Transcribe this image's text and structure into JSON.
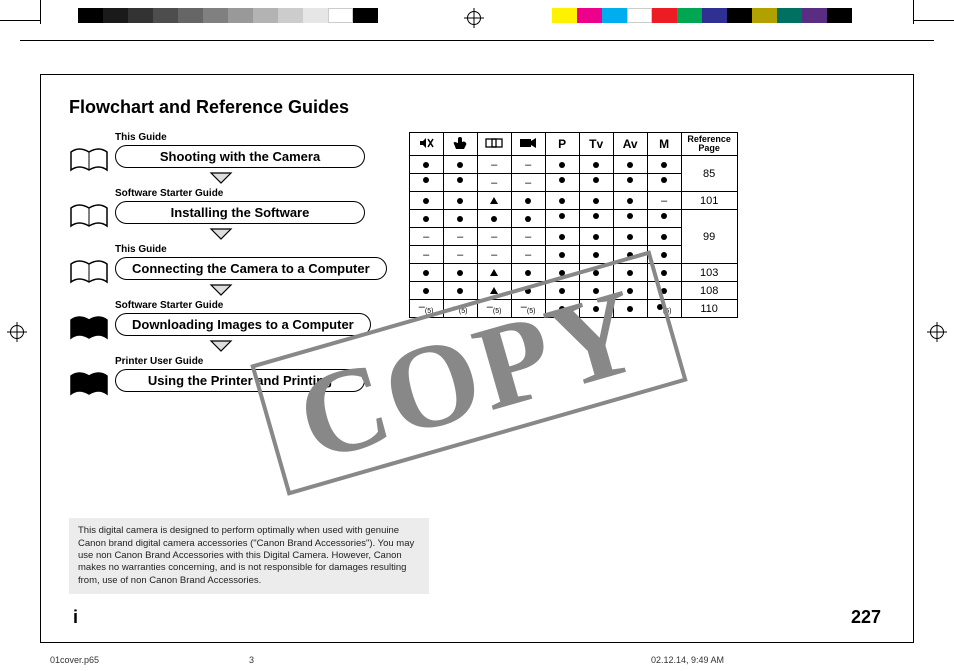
{
  "title": "Flowchart and Reference Guides",
  "steps": [
    {
      "guide": "This Guide",
      "label": "Shooting with the Camera",
      "book": "open"
    },
    {
      "guide": "Software Starter Guide",
      "label": "Installing the Software",
      "book": "open"
    },
    {
      "guide": "This Guide",
      "label": "Connecting the Camera to a Computer",
      "book": "open"
    },
    {
      "guide": "Software Starter Guide",
      "label": "Downloading Images to a Computer",
      "book": "solid"
    },
    {
      "guide": "Printer User Guide",
      "label": "Using the Printer and Printing",
      "book": "solid"
    }
  ],
  "table": {
    "headers": [
      "mute-icon",
      "hand-icon",
      "panorama-icon",
      "movie-icon",
      "P",
      "Tv",
      "Av",
      "M"
    ],
    "ref_header": "Reference Page",
    "rows": [
      {
        "cells": [
          "●",
          "●",
          "–",
          "–",
          "●",
          "●",
          "●",
          "●"
        ],
        "ref": "85",
        "refspan": 2
      },
      {
        "cells": [
          "●*",
          "●*",
          "–",
          "–",
          "●*",
          "●*",
          "●*",
          "●*"
        ],
        "ref": ""
      },
      {
        "cells": [
          "●",
          "●",
          "▲",
          "●",
          "●",
          "●",
          "●",
          "–"
        ],
        "ref": "101",
        "refspan": 1
      },
      {
        "cells": [
          "●",
          "●",
          "●",
          "●",
          "●*",
          "●*",
          "●*",
          "●*"
        ],
        "ref": "99",
        "refspan": 3
      },
      {
        "cells": [
          "–",
          "–",
          "–",
          "–",
          "●",
          "●",
          "●",
          "●"
        ],
        "ref": ""
      },
      {
        "cells": [
          "–",
          "–",
          "–",
          "–",
          "●",
          "●",
          "●",
          "●"
        ],
        "ref": ""
      },
      {
        "cells": [
          "●",
          "●",
          "▲",
          "●",
          "●",
          "●",
          "●",
          "●"
        ],
        "ref": "103",
        "refspan": 1
      },
      {
        "cells": [
          "●",
          "●",
          "▲",
          "●",
          "●",
          "●",
          "●",
          "●"
        ],
        "ref": "108",
        "refspan": 1
      },
      {
        "cells": [
          "–(5)",
          "–(5)",
          "–(5)",
          "–(5)",
          "●",
          "●",
          "●",
          "●(6)"
        ],
        "ref": "110",
        "refspan": 1
      }
    ]
  },
  "watermark": "COPY",
  "disclaimer": "This digital camera is designed to perform optimally when used with genuine Canon brand digital camera accessories (\"Canon Brand Accessories\").\nYou may use non Canon Brand Accessories with this Digital Camera. However, Canon makes no warranties concerning, and is not responsible for damages resulting from, use of non Canon Brand Accessories.",
  "page_left": "i",
  "page_right": "227",
  "footer": {
    "file": "01cover.p65",
    "page": "3",
    "timestamp": "02.12.14, 9:49 AM"
  },
  "colorbars_left": [
    "#000",
    "#1a1a1a",
    "#333",
    "#4d4d4d",
    "#666",
    "#808080",
    "#999",
    "#b3b3b3",
    "#ccc",
    "#e6e6e6",
    "#fff",
    "#000"
  ],
  "colorbars_right": [
    "#fff200",
    "#ec008c",
    "#00aeef",
    "#fff",
    "#ed1c24",
    "#00a651",
    "#2e3192",
    "#000",
    "#b0a000",
    "#007060",
    "#5a2d82",
    "#000"
  ]
}
